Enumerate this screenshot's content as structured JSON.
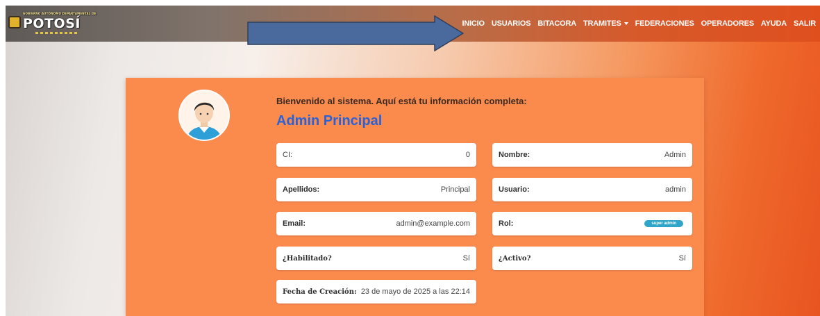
{
  "brand": {
    "name": "POTOSÍ",
    "tagline": "GOBIERNO AUTÓNOMO DEPARTAMENTAL DE"
  },
  "nav": {
    "items": [
      "INICIO",
      "USUARIOS",
      "BITACORA",
      "TRAMITES",
      "FEDERACIONES",
      "OPERADORES",
      "AYUDA",
      "SALIR"
    ]
  },
  "profile": {
    "welcome": "Bienvenido al sistema. Aquí está tu información completa:",
    "name": "Admin Principal",
    "fields": {
      "ci": {
        "label": "CI:",
        "value": "0"
      },
      "nombre": {
        "label": "Nombre:",
        "value": "Admin"
      },
      "apellidos": {
        "label": "Apellidos:",
        "value": "Principal"
      },
      "usuario": {
        "label": "Usuario:",
        "value": "admin"
      },
      "email": {
        "label": "Email:",
        "value": "admin@example.com"
      },
      "rol": {
        "label": "Rol:",
        "value": "super admin"
      },
      "habilitado": {
        "label": "¿Habilitado?",
        "value": "Sí"
      },
      "activo": {
        "label": "¿Activo?",
        "value": "Sí"
      },
      "fecha": {
        "label": "Fecha de Creación:",
        "value": "23 de mayo de 2025 a las 22:14"
      }
    }
  },
  "colors": {
    "accent": "#2a62d6",
    "card": "#fb8a4d",
    "badge": "#2fa6c9",
    "arrow": "#4a6a9e"
  }
}
